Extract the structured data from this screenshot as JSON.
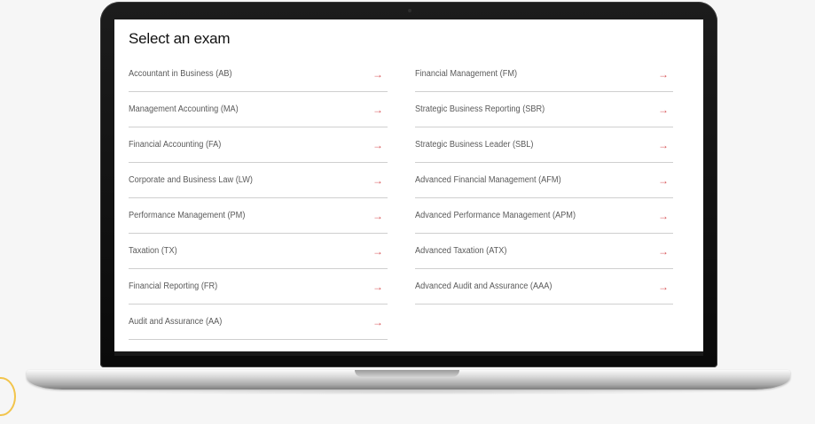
{
  "page": {
    "heading": "Select an exam"
  },
  "colors": {
    "accent_arrow": "#d8585a",
    "divider": "#cfcfcf",
    "highlight_circle": "#f2c44b"
  },
  "icons": {
    "exam_arrow": "arrow-right-icon"
  },
  "exams": {
    "left": [
      {
        "label": "Accountant in Business (AB)",
        "arrow": "→"
      },
      {
        "label": "Management Accounting (MA)",
        "arrow": "→"
      },
      {
        "label": "Financial Accounting (FA)",
        "arrow": "→"
      },
      {
        "label": "Corporate and Business Law (LW)",
        "arrow": "→"
      },
      {
        "label": "Performance Management (PM)",
        "arrow": "→"
      },
      {
        "label": "Taxation (TX)",
        "arrow": "→"
      },
      {
        "label": "Financial Reporting (FR)",
        "arrow": "→"
      },
      {
        "label": "Audit and Assurance (AA)",
        "arrow": "→"
      }
    ],
    "right": [
      {
        "label": "Financial Management (FM)",
        "arrow": "→"
      },
      {
        "label": "Strategic Business Reporting (SBR)",
        "arrow": "→"
      },
      {
        "label": "Strategic Business Leader (SBL)",
        "arrow": "→"
      },
      {
        "label": "Advanced Financial Management (AFM)",
        "arrow": "→"
      },
      {
        "label": "Advanced Performance Management (APM)",
        "arrow": "→"
      },
      {
        "label": "Advanced Taxation (ATX)",
        "arrow": "→"
      },
      {
        "label": "Advanced Audit and Assurance (AAA)",
        "arrow": "→"
      }
    ]
  }
}
